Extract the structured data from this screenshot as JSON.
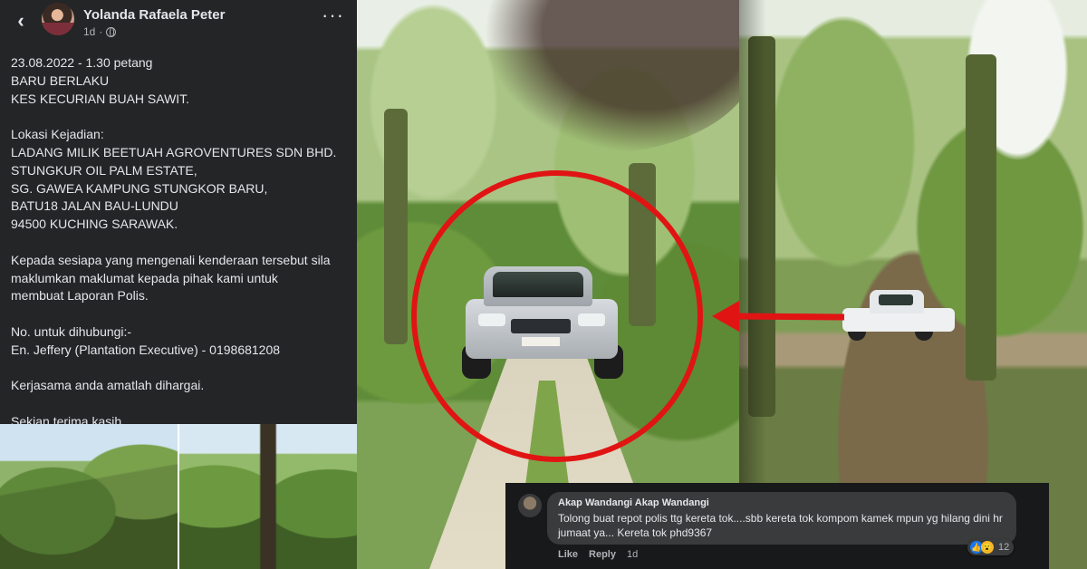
{
  "post": {
    "author": "Yolanda Rafaela Peter",
    "time": "1d",
    "separator": "·",
    "lines": [
      "23.08.2022 - 1.30 petang",
      "BARU BERLAKU",
      "KES KECURIAN BUAH SAWIT.",
      "",
      "Lokasi Kejadian:",
      "LADANG MILIK BEETUAH AGROVENTURES SDN BHD.",
      "STUNGKUR OIL PALM ESTATE,",
      "SG. GAWEA KAMPUNG STUNGKOR BARU,",
      "BATU18 JALAN BAU-LUNDU",
      "94500 KUCHING SARAWAK.",
      "",
      "Kepada sesiapa yang mengenali kenderaan tersebut sila",
      "maklumkan maklumat kepada pihak kami untuk",
      "membuat Laporan Polis.",
      "",
      "No. untuk dihubungi:-",
      "En. Jeffery (Plantation Executive) - 0198681208",
      "",
      "Kerjasama anda amatlah dihargai.",
      "",
      "Sekian terima kasih"
    ]
  },
  "icons": {
    "back": "chevron-left-icon",
    "more": "more-options-icon",
    "privacy": "globe-icon"
  },
  "comment": {
    "author": "Akap Wandangi Akap Wandangi",
    "text": "Tolong buat repot polis ttg kereta tok....sbb kereta tok kompom kamek mpun yg hilang dini hr jumaat ya... Kereta tok phd9367",
    "like_label": "Like",
    "reply_label": "Reply",
    "time": "1d",
    "reaction_count": "12"
  },
  "colors": {
    "highlight": "#e11414",
    "panel": "#242526",
    "text": "#e4e6eb"
  }
}
